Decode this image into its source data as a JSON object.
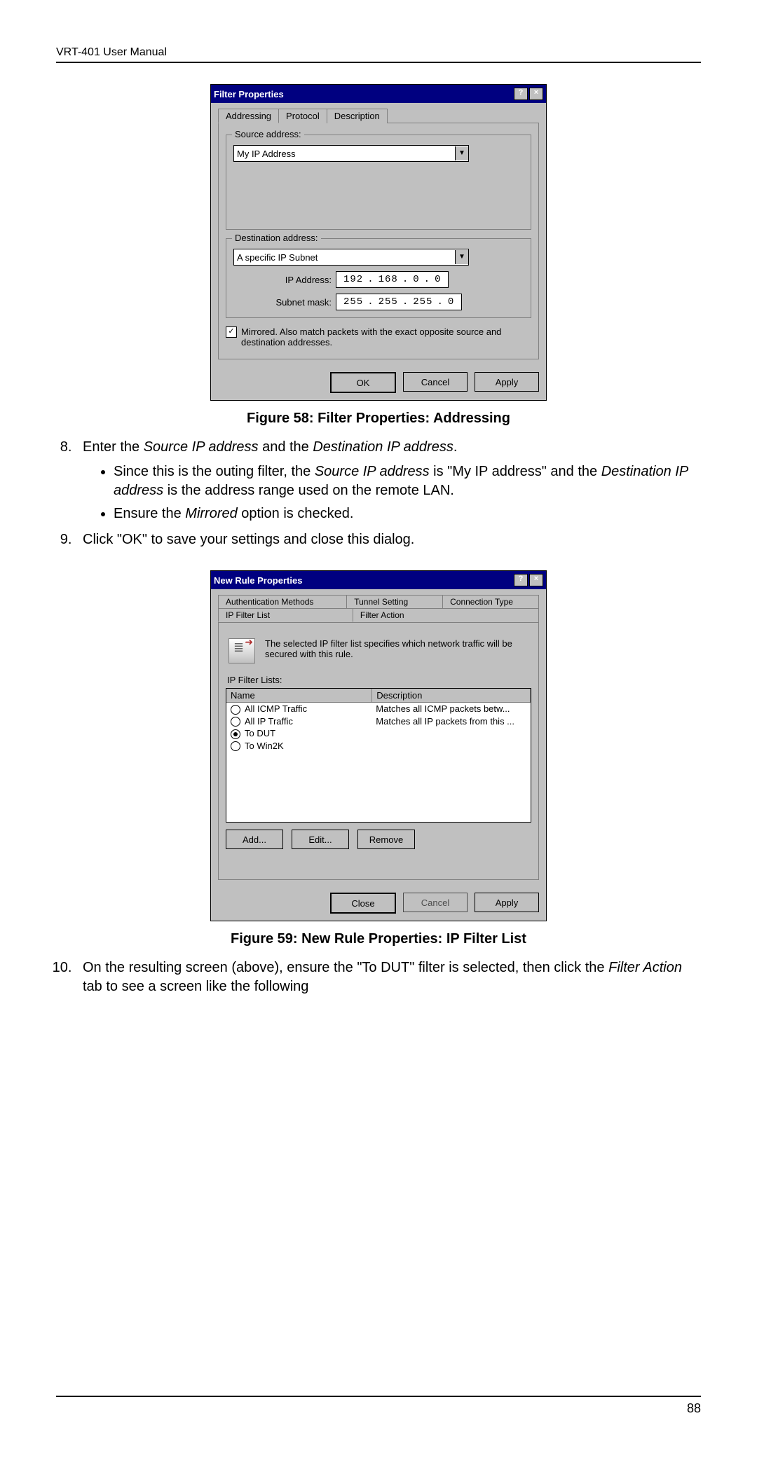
{
  "header": "VRT-401 User Manual",
  "page_number": "88",
  "fig58_caption": "Figure 58: Filter Properties: Addressing",
  "fig59_caption": "Figure 59: New Rule Properties: IP Filter List",
  "step8_lead": "Enter the ",
  "step8_src": "Source IP address",
  "step8_mid": " and the ",
  "step8_dst": "Destination IP address",
  "step8_end": ".",
  "bullet1_a": "Since this is the outing filter, the ",
  "bullet1_b": "Source IP address",
  "bullet1_c": " is \"My IP address\" and the ",
  "bullet1_d": "Destination IP address",
  "bullet1_e": " is the address range used on the remote LAN.",
  "bullet2_a": "Ensure the ",
  "bullet2_b": "Mirrored",
  "bullet2_c": " option is checked.",
  "step9": "Click \"OK\" to save your settings and close this dialog.",
  "step10_a": "On the resulting screen (above), ensure the \"To DUT\" filter is selected, then click the ",
  "step10_b": "Filter Action",
  "step10_c": " tab to see a screen like the following",
  "dlg1": {
    "title": "Filter Properties",
    "tabs": {
      "addressing": "Addressing",
      "protocol": "Protocol",
      "description": "Description"
    },
    "source_group": "Source address:",
    "source_value": "My IP Address",
    "dest_group": "Destination address:",
    "dest_value": "A specific IP Subnet",
    "ip_label": "IP Address:",
    "ip_oct": [
      "192",
      "168",
      "0",
      "0"
    ],
    "mask_label": "Subnet mask:",
    "mask_oct": [
      "255",
      "255",
      "255",
      "0"
    ],
    "mirrored": "Mirrored. Also match packets with the exact opposite source and destination addresses.",
    "ok": "OK",
    "cancel": "Cancel",
    "apply": "Apply"
  },
  "dlg2": {
    "title": "New Rule Properties",
    "tabs": {
      "auth": "Authentication Methods",
      "tunnel": "Tunnel Setting",
      "conn": "Connection Type",
      "ipfilter": "IP Filter List",
      "action": "Filter Action"
    },
    "info": "The selected IP filter list specifies which network traffic will be secured with this rule.",
    "list_label": "IP Filter Lists:",
    "col_name": "Name",
    "col_desc": "Description",
    "rows": [
      {
        "sel": false,
        "name": "All ICMP Traffic",
        "desc": "Matches all ICMP packets betw..."
      },
      {
        "sel": false,
        "name": "All IP Traffic",
        "desc": "Matches all IP packets from this ..."
      },
      {
        "sel": true,
        "name": "To DUT",
        "desc": ""
      },
      {
        "sel": false,
        "name": "To Win2K",
        "desc": ""
      }
    ],
    "add": "Add...",
    "edit": "Edit...",
    "remove": "Remove",
    "close": "Close",
    "cancel": "Cancel",
    "apply": "Apply"
  }
}
